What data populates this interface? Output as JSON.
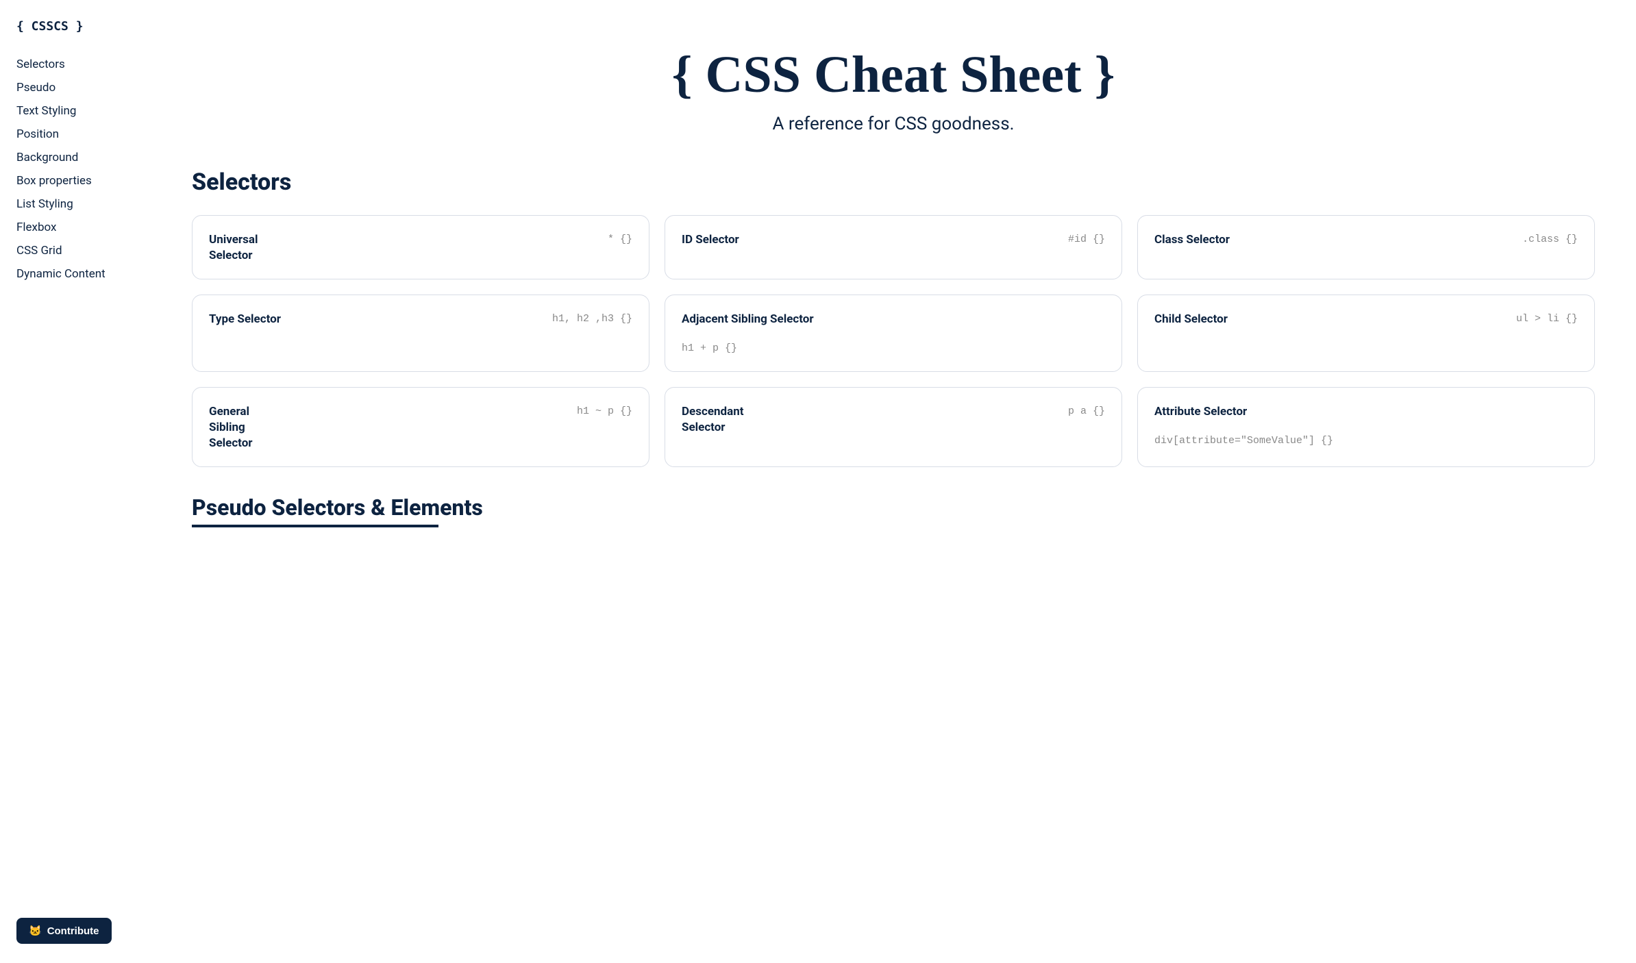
{
  "sidebar": {
    "logo": "{ CSSCS }",
    "nav_items": [
      "Selectors",
      "Pseudo",
      "Text Styling",
      "Position",
      "Background",
      "Box properties",
      "List Styling",
      "Flexbox",
      "CSS Grid",
      "Dynamic Content"
    ],
    "contribute_label": "Contribute",
    "contribute_icon": "🐱"
  },
  "hero": {
    "title": "{ CSS Cheat Sheet }",
    "subtitle": "A reference for CSS goodness."
  },
  "sections": [
    {
      "id": "selectors",
      "title": "Selectors",
      "rows": [
        [
          {
            "name": "Universal Selector",
            "code": "* {}",
            "multiline": false
          },
          {
            "name": "ID Selector",
            "code": "#id {}",
            "multiline": false
          },
          {
            "name": "Class Selector",
            "code": ".class {}",
            "multiline": false
          }
        ],
        [
          {
            "name": "Type Selector",
            "code": "h1, h2 ,h3 {}",
            "multiline": false
          },
          {
            "name": "Adjacent Sibling Selector",
            "code": "h1 + p {}",
            "multiline": true
          },
          {
            "name": "Child Selector",
            "code": "ul > li {}",
            "multiline": false
          }
        ],
        [
          {
            "name": "General Sibling Selector",
            "code": "h1 ~ p {}",
            "multiline": false
          },
          {
            "name": "Descendant Selector",
            "code": "p a {}",
            "multiline": false
          },
          {
            "name": "Attribute Selector",
            "code": "div[attribute=\"SomeValue\"] {}",
            "multiline": true
          }
        ]
      ]
    }
  ],
  "pseudo_section_title": "Pseudo Selectors & Elements"
}
